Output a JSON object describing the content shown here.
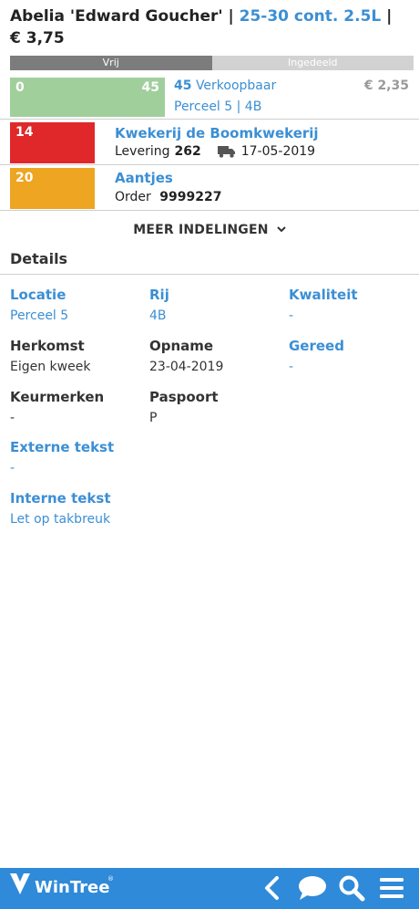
{
  "header": {
    "product": "Abelia 'Edward Goucher'",
    "sep1": "|",
    "size": "25-30 cont. 2.5L",
    "sep2": "|",
    "price": "€ 3,75"
  },
  "bar": {
    "free_label": "Vrij",
    "assigned_label": "Ingedeeld",
    "free_fraction": 0.5
  },
  "rows": [
    {
      "left_num": "0",
      "right_num": "45",
      "qty": "45",
      "status": "Verkoopbaar",
      "location": "Perceel 5 | 4B",
      "price": "€ 2,35",
      "color": "#a0cf9c"
    },
    {
      "num": "14",
      "name": "Kwekerij de Boomkwekerij",
      "delivery_label": "Levering",
      "delivery_num": "262",
      "truck_icon": "truck-icon",
      "date": "17-05-2019",
      "color": "#e0282a"
    },
    {
      "num": "20",
      "name": "Aantjes",
      "order_label": "Order",
      "order_num": "9999227",
      "color": "#eea522"
    }
  ],
  "more": {
    "label": "MEER INDELINGEN",
    "icon": "chevron-down-icon"
  },
  "details": {
    "title": "Details",
    "fields": {
      "locatie": {
        "label": "Locatie",
        "value": "Perceel 5"
      },
      "rij": {
        "label": "Rij",
        "value": "4B"
      },
      "kwaliteit": {
        "label": "Kwaliteit",
        "value": "-"
      },
      "herkomst": {
        "label": "Herkomst",
        "value": "Eigen kweek"
      },
      "opname": {
        "label": "Opname",
        "value": "23-04-2019"
      },
      "gereed": {
        "label": "Gereed",
        "value": "-"
      },
      "keurmerken": {
        "label": "Keurmerken",
        "value": "-"
      },
      "paspoort": {
        "label": "Paspoort",
        "value": "P"
      },
      "externe": {
        "label": "Externe tekst",
        "value": "-"
      },
      "interne": {
        "label": "Interne tekst",
        "value": "Let op takbreuk"
      }
    }
  },
  "footer": {
    "logo_text": "WinTree",
    "logo_reg": "®",
    "icons": [
      "back-icon",
      "chat-icon",
      "search-icon",
      "menu-icon"
    ],
    "color": "#2f8ad9"
  }
}
